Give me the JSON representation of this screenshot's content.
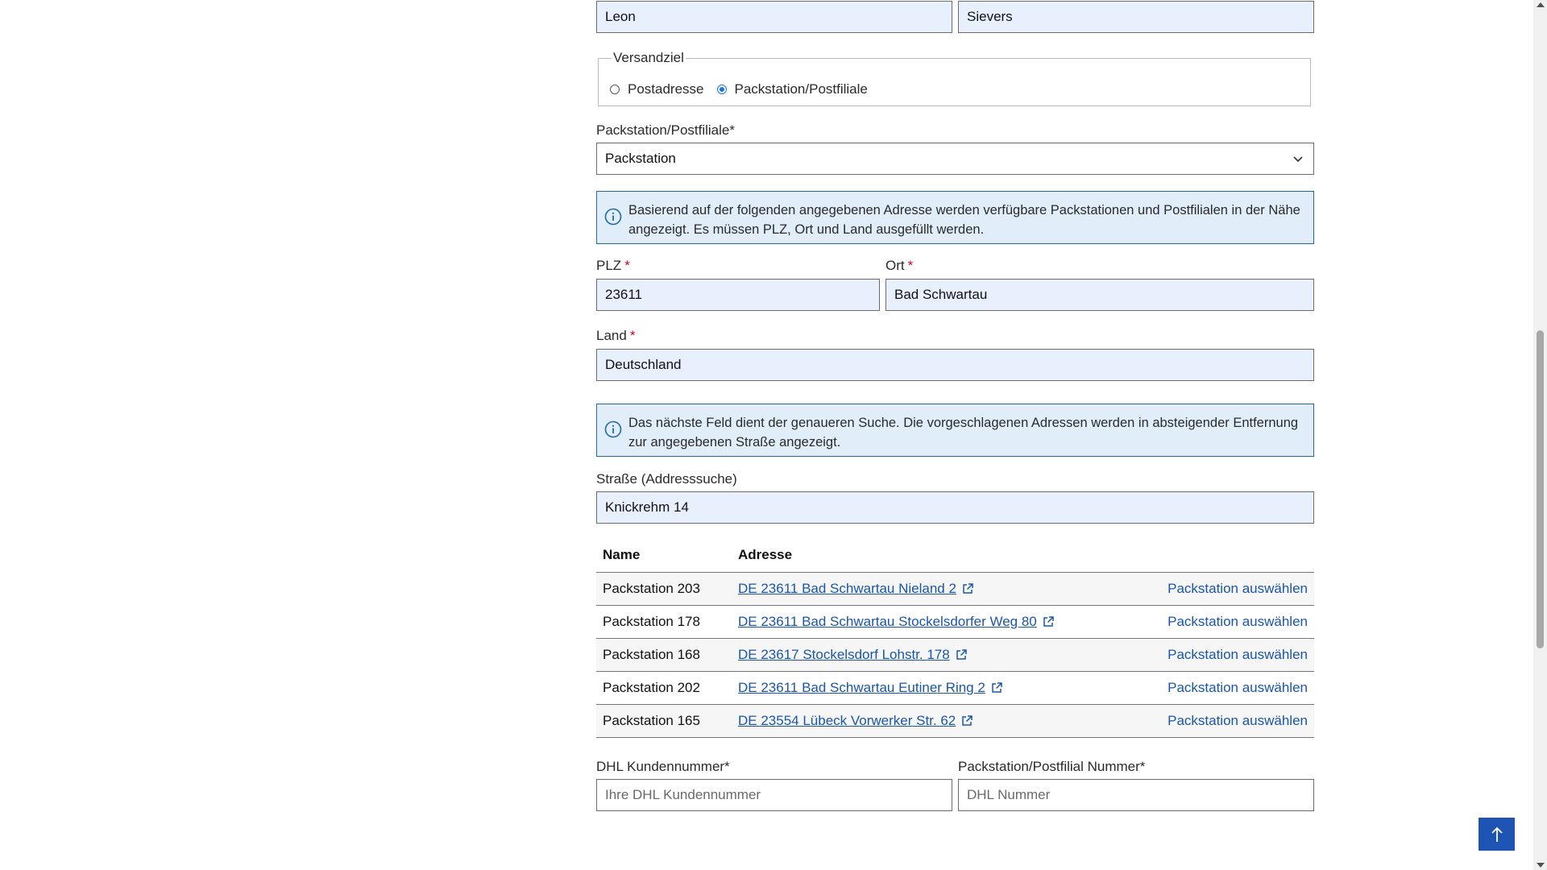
{
  "name": {
    "first": "Leon",
    "last": "Sievers"
  },
  "versand": {
    "legend": "Versandziel",
    "options": [
      "Postadresse",
      "Packstation/Postfiliale"
    ],
    "selected": "Packstation/Postfiliale"
  },
  "station_type": {
    "label": "Packstation/Postfiliale*",
    "value": "Packstation"
  },
  "info1": "Basierend auf der folgenden angegebenen Adresse werden verfügbare Packstationen und Postfilialen in der Nähe angezeigt. Es müssen PLZ, Ort und Land ausgefüllt werden.",
  "plz": {
    "label": "PLZ",
    "value": "23611"
  },
  "ort": {
    "label": "Ort",
    "value": "Bad Schwartau"
  },
  "land": {
    "label": "Land",
    "value": "Deutschland"
  },
  "required_mark": "*",
  "info2": "Das nächste Feld dient der genaueren Suche. Die vorgeschlagenen Adressen werden in absteigender Entfernung zur angegebenen Straße angezeigt.",
  "strasse": {
    "label": "Straße (Addresssuche)",
    "value": "Knickrehm 14"
  },
  "table": {
    "headers": {
      "name": "Name",
      "address": "Adresse"
    },
    "select_label": "Packstation auswählen",
    "rows": [
      {
        "name": "Packstation 203",
        "address": "DE 23611 Bad Schwartau Nieland 2"
      },
      {
        "name": "Packstation 178",
        "address": "DE 23611 Bad Schwartau Stockelsdorfer Weg 80"
      },
      {
        "name": "Packstation 168",
        "address": "DE 23617 Stockelsdorf Lohstr. 178"
      },
      {
        "name": "Packstation 202",
        "address": "DE 23611 Bad Schwartau Eutiner Ring 2"
      },
      {
        "name": "Packstation 165",
        "address": "DE 23554 Lübeck Vorwerker Str. 62"
      }
    ]
  },
  "dhl_kunde": {
    "label": "DHL Kundennummer*",
    "placeholder": "Ihre DHL Kundennummer"
  },
  "dhl_nummer": {
    "label": "Packstation/Postfilial Nummer*",
    "placeholder": "DHL Nummer"
  },
  "icons": {
    "info": "info-icon",
    "external": "external-link-icon",
    "chevron": "chevron-down-icon",
    "to_top": "arrow-up-icon"
  },
  "colors": {
    "accent": "#1d54b4",
    "link": "#1a56a8",
    "info_bg": "#e1eefa",
    "input_filled": "#e8f0fe",
    "required": "#d0021b"
  }
}
